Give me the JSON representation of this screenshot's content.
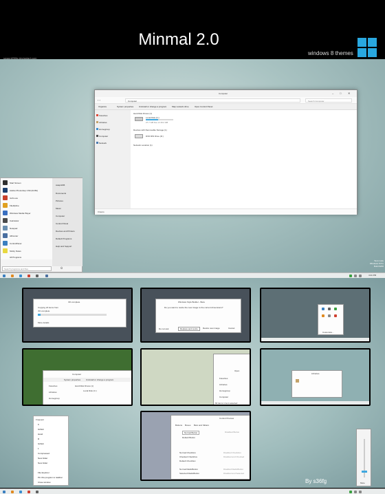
{
  "header": {
    "title": "Minmal 2.0",
    "subtitle": "windows 8 themes",
    "credit": "swapnil36fg.deviantart.com",
    "logo_color": "#29a8e0"
  },
  "explorer": {
    "title": "Computer",
    "address": "Computer",
    "search_placeholder": "Search Computer",
    "commands": [
      "Organize",
      "System properties",
      "Uninstall or change a program",
      "Map network drive",
      "Open Control Panel"
    ],
    "nav": [
      {
        "label": "Favorites",
        "color": "#e04a3a"
      },
      {
        "label": "Libraries",
        "color": "#c4a36a"
      },
      {
        "label": "Homegroup",
        "color": "#3a8fd0"
      },
      {
        "label": "Computer",
        "color": "#555555"
      },
      {
        "label": "Network",
        "color": "#4a7ab0"
      }
    ],
    "groups": [
      {
        "label": "Hard Disk Drives (1)",
        "items": [
          {
            "name": "Local Disk (C:)",
            "detail": "27.7 GB free of 49.2 GB"
          }
        ]
      },
      {
        "label": "Devices with Removable Storage (1)",
        "items": [
          {
            "name": "DVD RW Drive (D:)",
            "detail": ""
          }
        ]
      },
      {
        "label": "Network Location (1)",
        "items": []
      }
    ],
    "status": "3 items"
  },
  "startmenu": {
    "left_items": [
      {
        "label": "Start Screen",
        "color": "#2e2e2e"
      },
      {
        "label": "Adobe Photoshop CS6 (64 Bit)",
        "color": "#1b3f6e"
      },
      {
        "label": "Icofx.exe",
        "color": "#c8402a"
      },
      {
        "label": "FileZipline",
        "color": "#e0a020"
      },
      {
        "label": "Windows Media Player",
        "color": "#3a6fc0"
      },
      {
        "label": "Calculator",
        "color": "#4a4a4a"
      },
      {
        "label": "Notepad",
        "color": "#6a8fb0"
      },
      {
        "label": "AllCenter",
        "color": "#4a6fa0"
      },
      {
        "label": "ControlPanel",
        "color": "#3a7fc0"
      },
      {
        "label": "Sticky Notes",
        "color": "#e8d840"
      }
    ],
    "all_programs": "All Programs",
    "right_items": [
      "swapnil36",
      "Documents",
      "Pictures",
      "Music",
      "Computer",
      "Control Panel",
      "Devices and Printers",
      "Default Programs",
      "Help and Support"
    ],
    "search_placeholder": "Search programs and files"
  },
  "buildinfo": {
    "line1": "Test mode",
    "line2": "Windows 8 Pro",
    "line3": "Build 9200"
  },
  "taskbar": {
    "clock": "4:41 PM"
  },
  "thumbs": {
    "copy": {
      "title": "4% complete",
      "line1": "Copying 24 items from",
      "line2": "4% complete",
      "more": "More details"
    },
    "replace": {
      "title": "Windows Style Builder - Beta",
      "msg": "Do you want to resize the new image to the current dimensions?",
      "b1": "Replace and resize",
      "b2": "Replace image",
      "b3": "Resize new image",
      "b4": "Cancel",
      "check": "Do not ask"
    },
    "tray": {
      "label": "Customize..."
    },
    "explorer2": {
      "address": "Computer",
      "group": "Hard Disk Drives (1)",
      "disk": "Local Disk (C:)",
      "fav": "Favorites",
      "lib": "Libraries",
      "home": "Homegroup",
      "cmd1": "System properties",
      "cmd2": "Uninstall or change a program",
      "cmd3": "Map network"
    },
    "small": {
      "open": "Open",
      "fav": "Favorites",
      "lib": "Libraries",
      "home": "Homegroup",
      "comp": "Computer",
      "status": "60 items   1 item selected"
    },
    "libraries": {
      "title": "Libraries"
    },
    "controls": {
      "title": "Control Preview",
      "tab1": "Buttons",
      "tab2": "Boxes",
      "tab3": "Bars and Sliders",
      "btn1": "Normal Button",
      "btn2": "Default Button",
      "btn3": "Disabled Button",
      "c1": "Normal Checkbox",
      "c2": "Checked Checkbox",
      "c3": "Default Checkbox",
      "c4": "Disabled Checkbox",
      "c5": "Disabled and Checked",
      "r1": "Normal RadioButton",
      "r2": "Selected RadioButton",
      "r3": "Disabled RadioButton",
      "r4": "Disabled and Selected"
    }
  },
  "contextmenu": {
    "header": "Frequent",
    "items": [
      "K",
      "Github",
      "Hand",
      "R",
      "Github",
      "1",
      "Compressed",
      "New folder",
      "New folder"
    ],
    "extra": [
      "File Explorer",
      "Pin this program to taskbar",
      "Close window"
    ]
  },
  "volume": {
    "label": "Mute"
  },
  "byline": "By s36fg"
}
